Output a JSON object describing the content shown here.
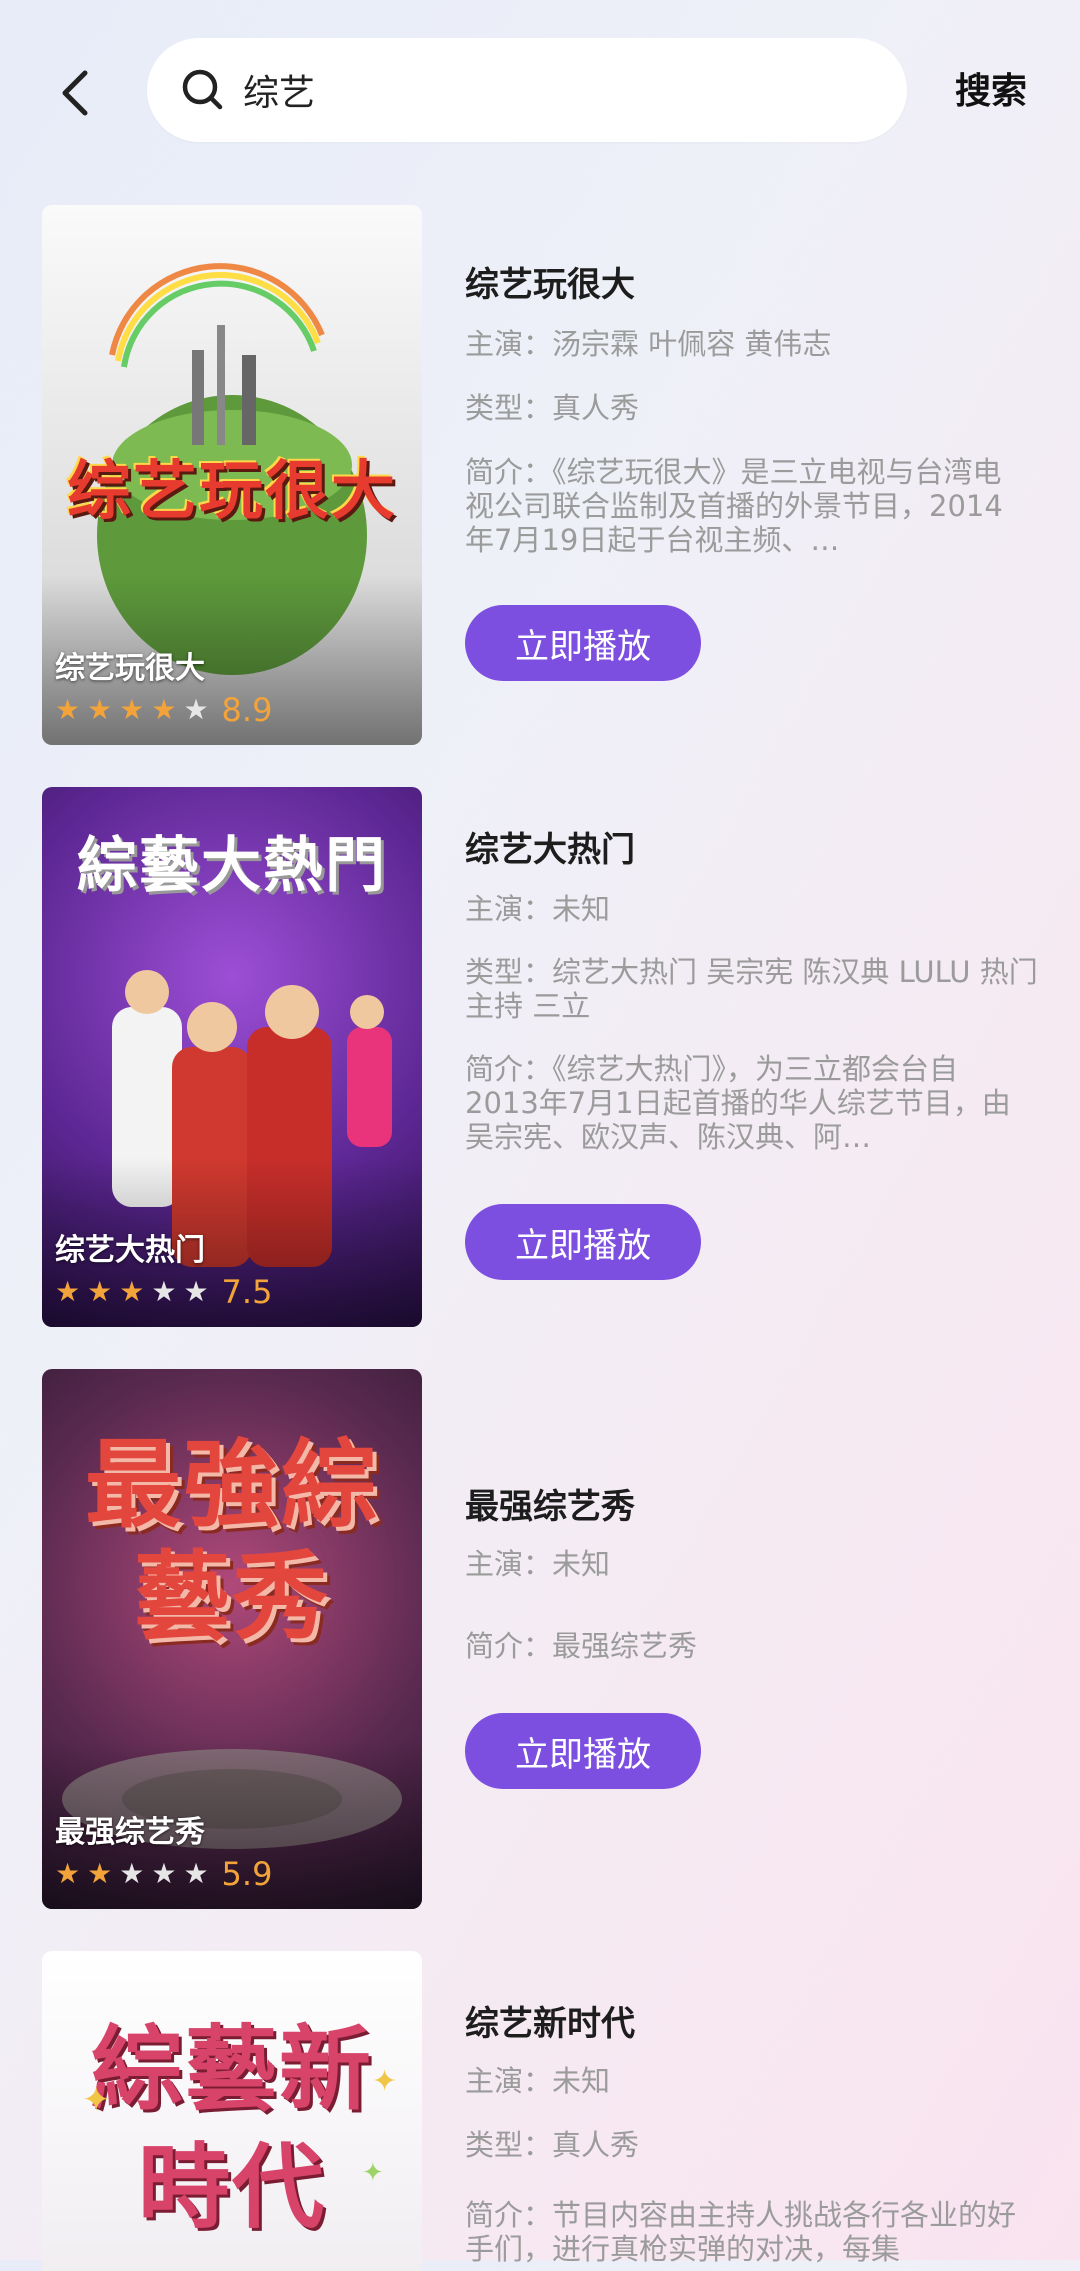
{
  "search": {
    "query": "综艺",
    "button_label": "搜索"
  },
  "colors": {
    "accent": "#7d4fe0",
    "star": "#f2a33a"
  },
  "results": [
    {
      "poster_title": "综艺玩很大",
      "poster_art_text": "综艺玩很大",
      "stars_on": 4,
      "score": "8.9",
      "title": "综艺玩很大",
      "cast": "主演：汤宗霖 叶佩容 黄伟志",
      "genre": "类型：真人秀",
      "summary": "简介：《综艺玩很大》是三立电视与台湾电视公司联合监制及首播的外景节目，2014年7月19日起于台视主频、…",
      "play_label": "立即播放"
    },
    {
      "poster_title": "综艺大热门",
      "poster_art_text": "綜藝大熱門",
      "stars_on": 3,
      "score": "7.5",
      "title": "综艺大热门",
      "cast": "主演：未知",
      "genre": "类型：综艺大热门 吴宗宪 陈汉典 LULU 热门 主持 三立",
      "summary": "简介：《综艺大热门》，为三立都会台自2013年7月1日起首播的华人综艺节目，由吴宗宪、欧汉声、陈汉典、阿…",
      "play_label": "立即播放"
    },
    {
      "poster_title": "最强综艺秀",
      "poster_art_text": "最強綜藝秀",
      "stars_on": 2,
      "score": "5.9",
      "title": "最强综艺秀",
      "cast": "主演：未知",
      "summary": "简介：最强综艺秀",
      "play_label": "立即播放"
    },
    {
      "poster_art_text": "綜藝新時代",
      "title": "综艺新时代",
      "cast": "主演：未知",
      "genre": "类型：真人秀",
      "summary": "简介：节目内容由主持人挑战各行各业的好手们，进行真枪实弹的对决，每集"
    }
  ]
}
